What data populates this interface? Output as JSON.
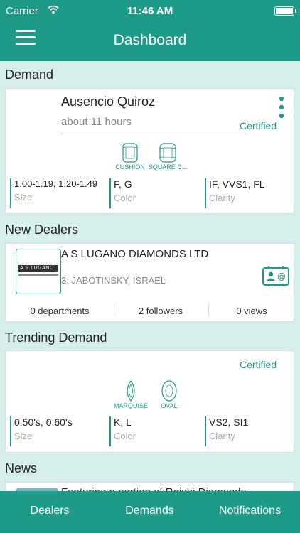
{
  "status_bar": {
    "carrier": "Carrier",
    "time": "11:46 AM"
  },
  "header": {
    "title": "Dashboard",
    "menu_icon": "hamburger-icon"
  },
  "demand": {
    "section_title": "Demand",
    "name": "Ausencio Quiroz",
    "time": "about 11 hours",
    "status": "Certified",
    "shapes": [
      "CUSHION",
      "SQUARE C..."
    ],
    "size_value": "1.00-1.19, 1.20-1.49",
    "size_label": "Size",
    "color_value": "F, G",
    "color_label": "Color",
    "clarity_value": "IF, VVS1, FL",
    "clarity_label": "Clarity"
  },
  "new_dealers": {
    "section_title": "New Dealers",
    "name": "A S LUGANO DIAMONDS LTD",
    "address": "3, JABOTINSKY, ISRAEL",
    "departments": "0 departments",
    "followers": "2 followers",
    "views": "0 views",
    "logo_text": "A.S.LUGANO"
  },
  "trending": {
    "section_title": "Trending Demand",
    "status": "Certified",
    "shapes": [
      "MARQUISE",
      "OVAL"
    ],
    "size_value": "0.50's, 0.60's",
    "size_label": "Size",
    "color_value": "K, L",
    "color_label": "Color",
    "clarity_value": "VS2, SI1",
    "clarity_label": "Clarity"
  },
  "news": {
    "section_title": "News",
    "headline": "Featuring a portion of Rajshi Diamonds"
  },
  "tabs": [
    "Dealers",
    "Demands",
    "Notifications"
  ],
  "colors": {
    "accent": "#1e9a88",
    "background": "#d6eeec"
  }
}
